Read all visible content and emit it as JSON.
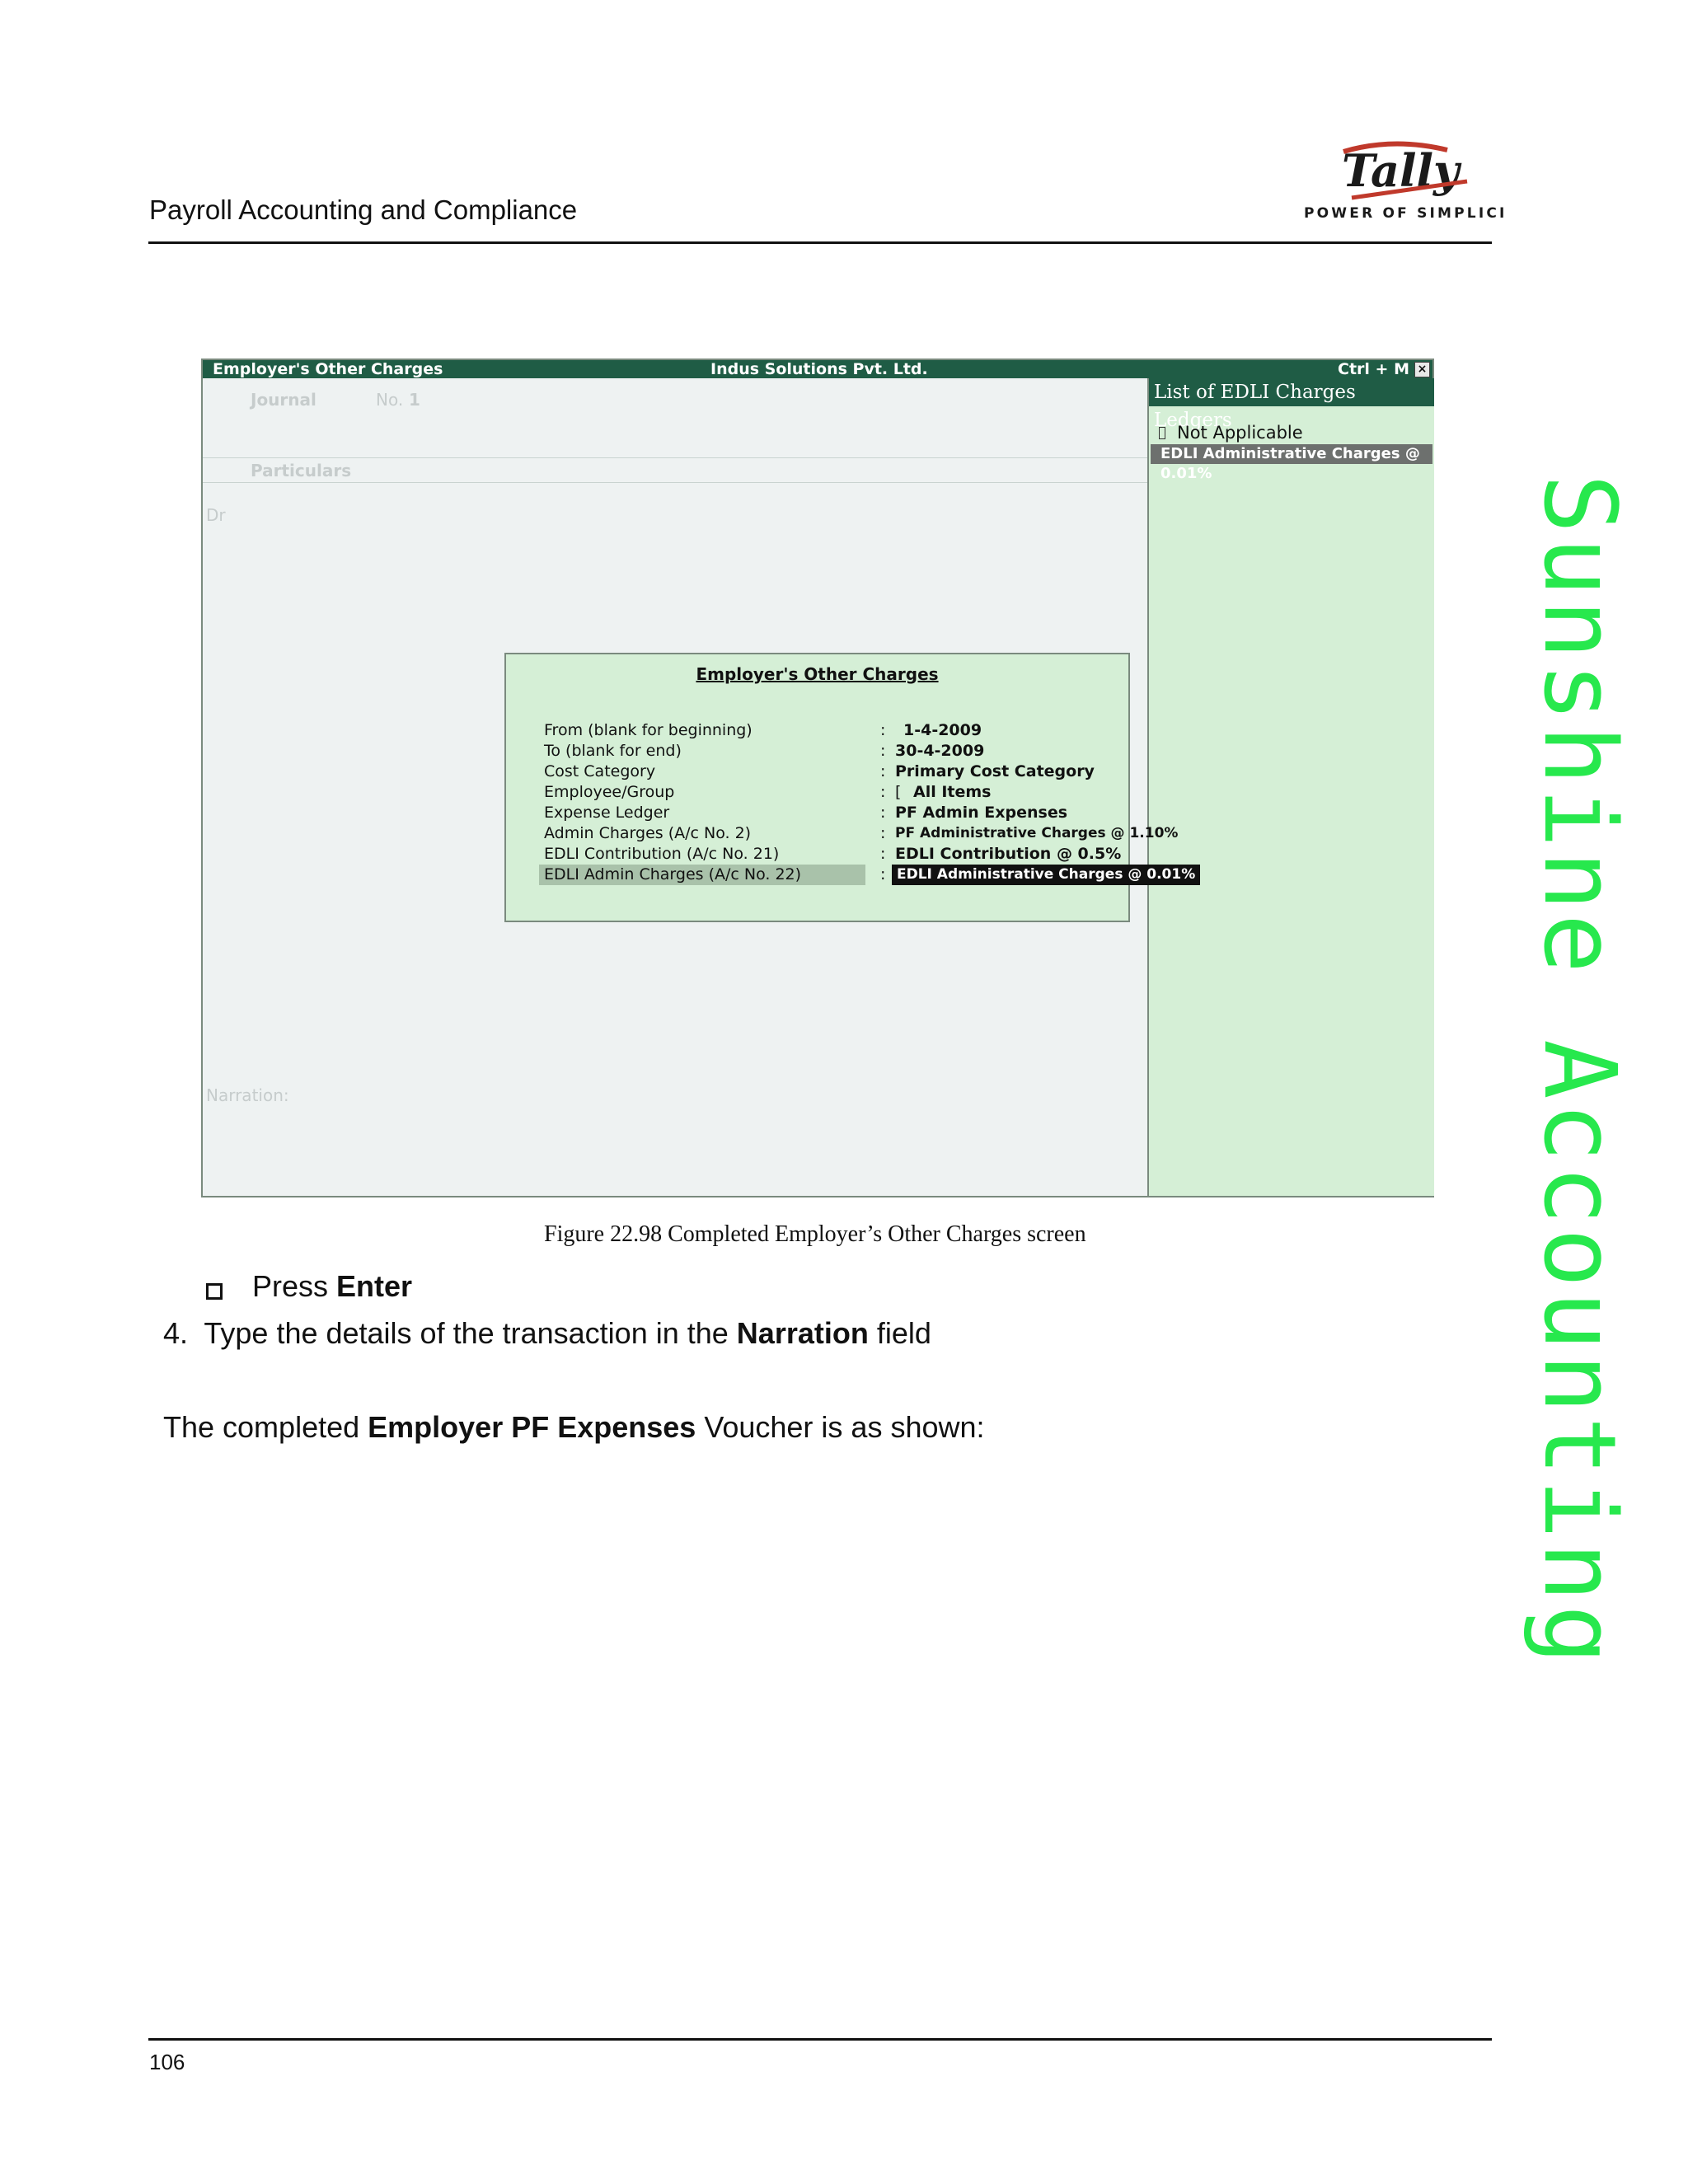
{
  "header": {
    "title": "Payroll Accounting and Compliance",
    "logo_text": "Tally",
    "logo_tagline": "POWER OF SIMPLICITY"
  },
  "screen": {
    "titlebar": {
      "left": "Employer's Other Charges",
      "center": "Indus Solutions Pvt. Ltd.",
      "right": "Ctrl + M",
      "close": "×"
    },
    "background": {
      "voucher_type": "Journal",
      "voucher_no_label": "No.",
      "voucher_no": "1",
      "particulars": "Particulars",
      "dr": "Dr",
      "narration": "Narration:"
    },
    "list_panel": {
      "title": "List of EDLI Charges Ledgers",
      "items": [
        "Not Applicable"
      ],
      "selected": "EDLI Administrative Charges @ 0.01%"
    },
    "dialog": {
      "title": "Employer's Other Charges",
      "rows": [
        {
          "label": "From (blank for beginning)",
          "value": "1-4-2009"
        },
        {
          "label": "To (blank for end)",
          "value": "30-4-2009"
        },
        {
          "label": "Cost Category",
          "value": "Primary Cost Category"
        },
        {
          "label": "Employee/Group",
          "value": "All Items"
        },
        {
          "label": "Expense Ledger",
          "value": "PF Admin Expenses"
        },
        {
          "label": "Admin Charges (A/c No. 2)",
          "value": "PF Administrative Charges @ 1.10%"
        },
        {
          "label": "EDLI Contribution (A/c No. 21)",
          "value": "EDLI Contribution @ 0.5%"
        },
        {
          "label": "EDLI Admin Charges (A/c No. 22)",
          "value": "EDLI Administrative Charges @ 0.01%"
        }
      ]
    }
  },
  "caption": "Figure 22.98  Completed Employer’s Other Charges screen",
  "bullet": {
    "text": "Press ",
    "bold": "Enter"
  },
  "step": {
    "number": "4.",
    "text_before": "Type the details of the transaction in the ",
    "bold": "Narration",
    "text_after": " field"
  },
  "paragraph": {
    "text_before": "The completed ",
    "bold": "Employer PF Expenses",
    "text_after": " Voucher is as shown:"
  },
  "page_number": "106",
  "watermark": "Sunshine Accounting",
  "colors": {
    "titlebar": "#1f5c45",
    "panel": "#d5efd6",
    "watermark": "#27e84d"
  }
}
